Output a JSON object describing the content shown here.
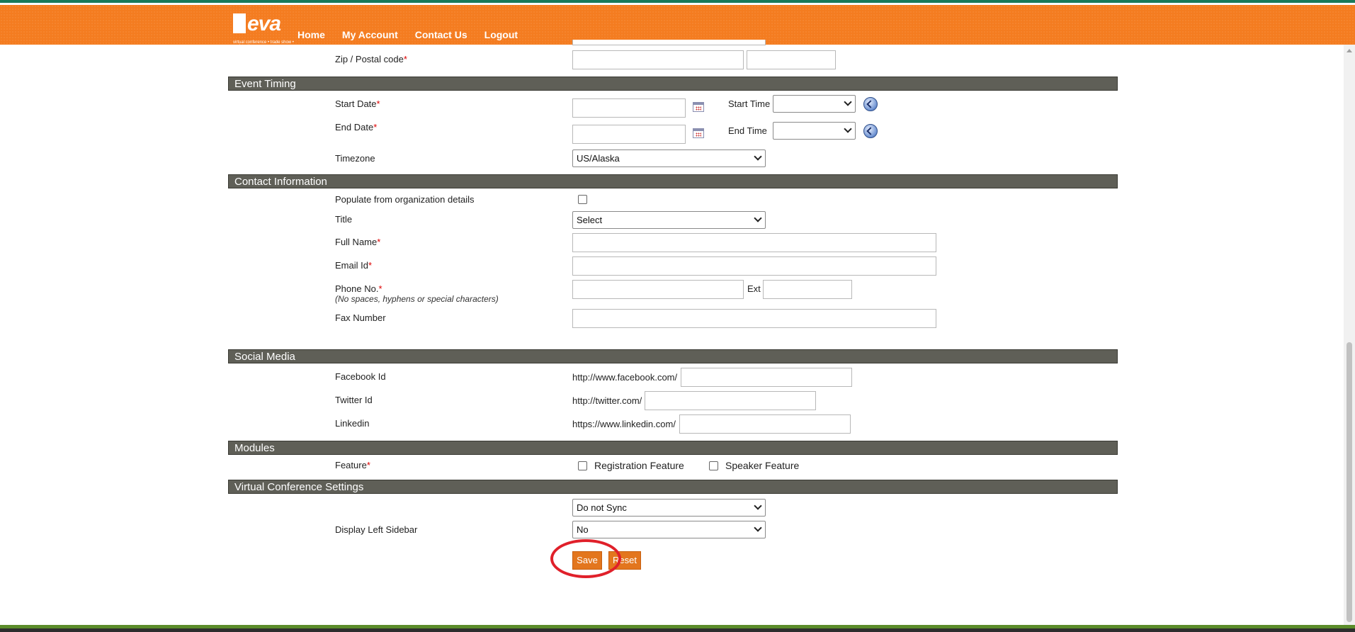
{
  "nav": {
    "logo_word": "eva",
    "logo_tagline": "virtual conference • trade show • registration",
    "links": [
      "Home",
      "My Account",
      "Contact Us",
      "Logout"
    ]
  },
  "location": {
    "zip_label": "Zip / Postal code",
    "zip_value": "",
    "zip_ext_value": ""
  },
  "event_timing": {
    "section_title": "Event Timing",
    "start_date_label": "Start Date",
    "start_date_value": "",
    "start_time_label": "Start Time",
    "start_time_value": "",
    "end_date_label": "End Date",
    "end_date_value": "",
    "end_time_label": "End Time",
    "end_time_value": "",
    "timezone_label": "Timezone",
    "timezone_value": "US/Alaska"
  },
  "contact": {
    "section_title": "Contact Information",
    "populate_label": "Populate from organization details",
    "populate_checked": false,
    "title_label": "Title",
    "title_value": "Select",
    "full_name_label": "Full Name",
    "email_label": "Email Id",
    "phone_label": "Phone No.",
    "phone_hint": "(No spaces, hyphens or special characters)",
    "ext_label": "Ext",
    "fax_label": "Fax Number"
  },
  "social": {
    "section_title": "Social Media",
    "facebook_label": "Facebook Id",
    "facebook_prefix": "http://www.facebook.com/",
    "twitter_label": "Twitter Id",
    "twitter_prefix": "http://twitter.com/",
    "linkedin_label": "Linkedin",
    "linkedin_prefix": "https://www.linkedin.com/"
  },
  "modules": {
    "section_title": "Modules",
    "feature_label": "Feature",
    "registration_feature": "Registration Feature",
    "speaker_feature": "Speaker Feature",
    "registration_checked": false,
    "speaker_checked": false
  },
  "virtual_conference": {
    "section_title": "Virtual Conference Settings",
    "sync_value": "Do not Sync",
    "sidebar_label": "Display Left Sidebar",
    "sidebar_value": "No"
  },
  "actions": {
    "save_label": "Save",
    "reset_label": "Reset"
  },
  "required_mark": "*",
  "colors": {
    "header_orange": "#f47c20",
    "section_bar": "#5f5f57",
    "button_orange": "#e3761e",
    "annotation_red": "#e0202a"
  }
}
